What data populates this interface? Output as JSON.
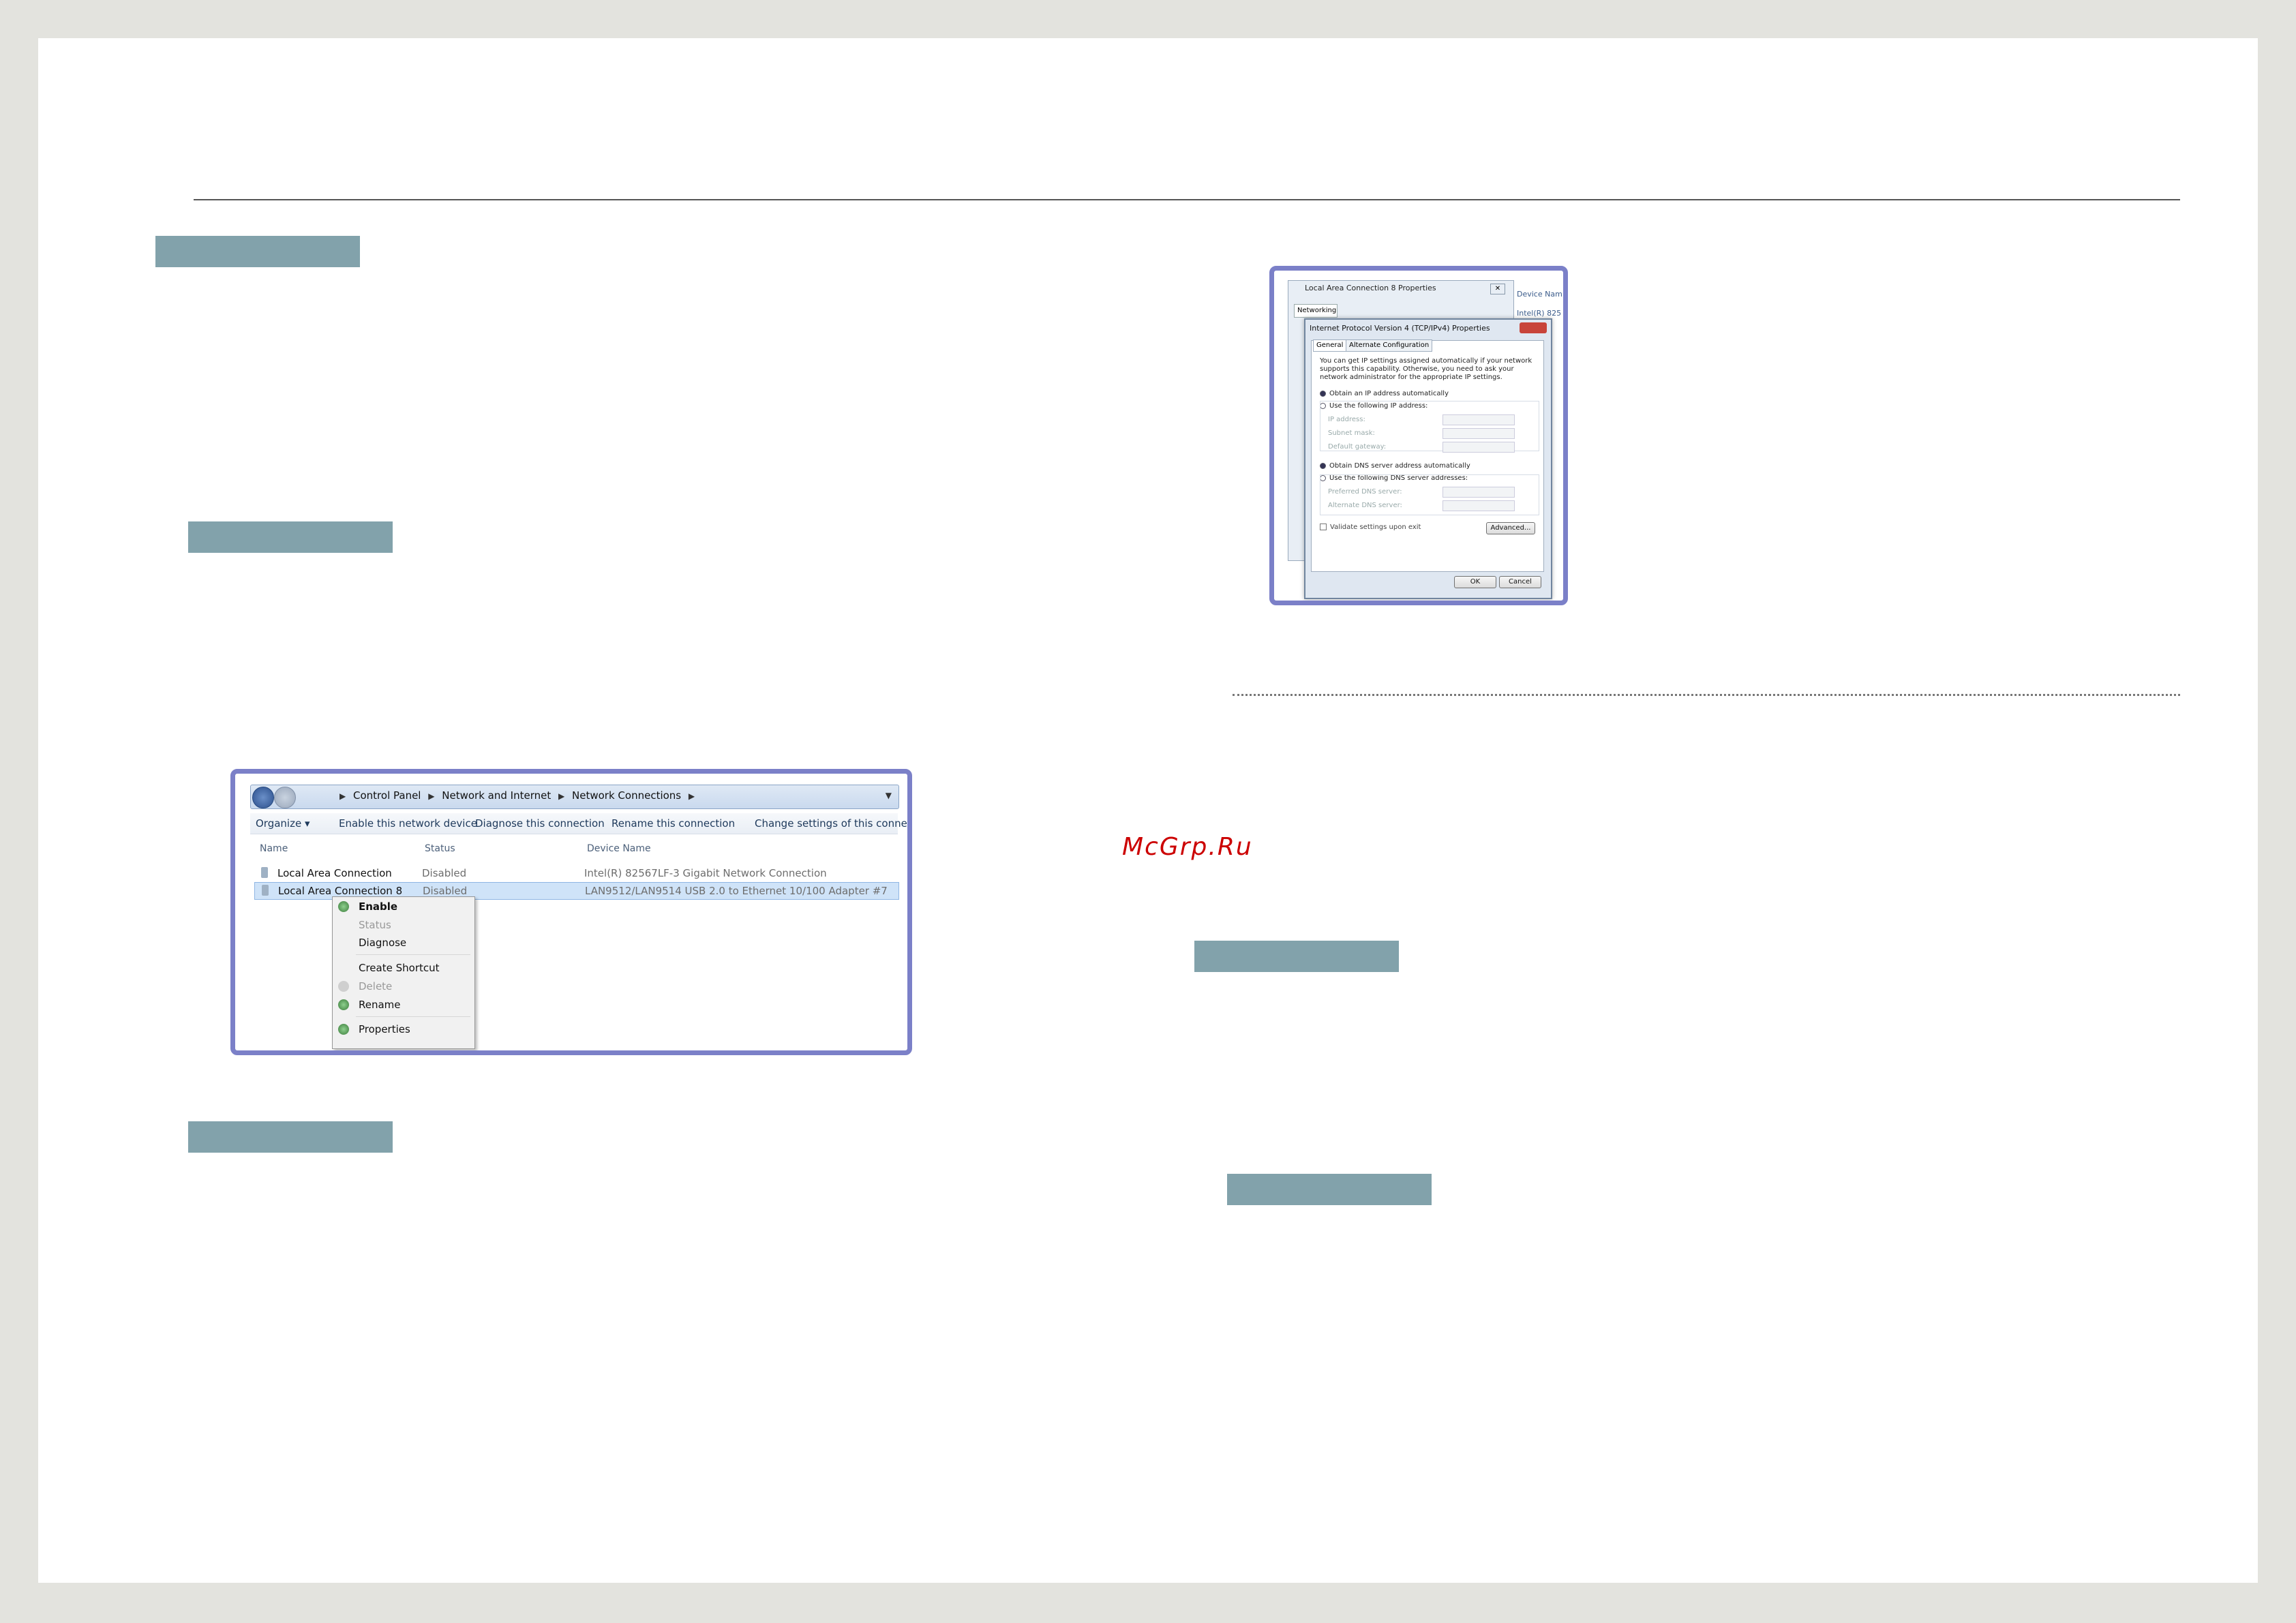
{
  "watermark": "McGrp.Ru",
  "network_connections": {
    "breadcrumb": [
      "Control Panel",
      "Network and Internet",
      "Network Connections"
    ],
    "toolbar": [
      "Organize ▾",
      "Enable this network device",
      "Diagnose this connection",
      "Rename this connection",
      "Change settings of this connecti"
    ],
    "columns": [
      "Name",
      "Status",
      "Device Name"
    ],
    "rows": [
      {
        "name": "Local Area Connection",
        "status": "Disabled",
        "device": "Intel(R) 82567LF-3 Gigabit Network Connection"
      },
      {
        "name": "Local Area Connection 8",
        "status": "Disabled",
        "device": "LAN9512/LAN9514 USB 2.0 to Ethernet 10/100 Adapter #7"
      }
    ],
    "context_menu": {
      "enable": "Enable",
      "status": "Status",
      "diagnose": "Diagnose",
      "create_shortcut": "Create Shortcut",
      "delete": "Delete",
      "rename": "Rename",
      "properties": "Properties"
    }
  },
  "properties_dialog": {
    "back_title": "Local Area Connection 8 Properties",
    "back_tab": "Networking",
    "side_labels": [
      "Device Nam",
      "Intel(R) 825"
    ],
    "title": "Internet Protocol Version 4 (TCP/IPv4) Properties",
    "tabs": [
      "General",
      "Alternate Configuration"
    ],
    "description": "You can get IP settings assigned automatically if your network supports this capability. Otherwise, you need to ask your network administrator for the appropriate IP settings.",
    "ip_auto": "Obtain an IP address automatically",
    "ip_manual": "Use the following IP address:",
    "ip_fields": [
      "IP address:",
      "Subnet mask:",
      "Default gateway:"
    ],
    "dns_auto": "Obtain DNS server address automatically",
    "dns_manual": "Use the following DNS server addresses:",
    "dns_fields": [
      "Preferred DNS server:",
      "Alternate DNS server:"
    ],
    "validate": "Validate settings upon exit",
    "advanced": "Advanced...",
    "ok": "OK",
    "cancel": "Cancel"
  }
}
